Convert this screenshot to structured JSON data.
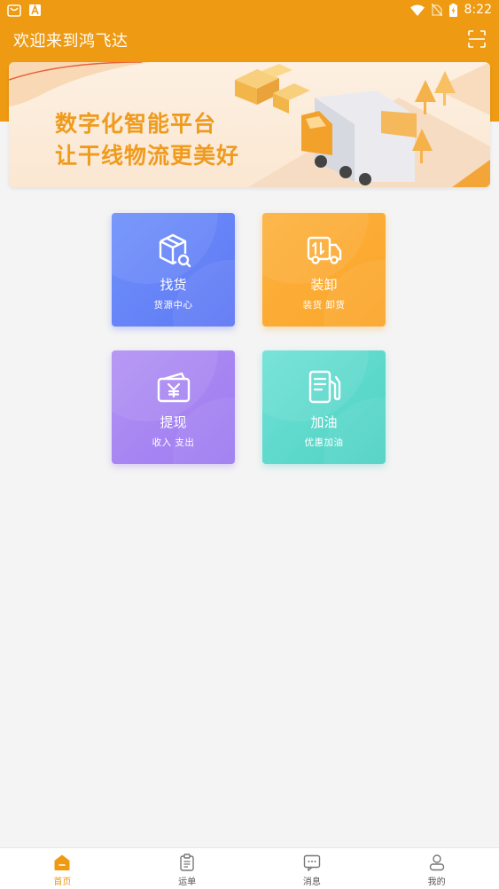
{
  "status_bar": {
    "time": "8:22",
    "left_icons": [
      "shopping-bag-icon",
      "android-a-icon"
    ],
    "right_icons": [
      "wifi-icon",
      "no-sim-icon",
      "battery-icon"
    ]
  },
  "header": {
    "title": "欢迎来到鸿飞达",
    "scan_icon": "scan-icon"
  },
  "banner": {
    "line1": "数字化智能平台",
    "line2": "让干线物流更美好"
  },
  "cards": [
    {
      "title": "找货",
      "subtitle": "货源中心",
      "icon": "box-search-icon",
      "color": "#6584f8"
    },
    {
      "title": "装卸",
      "subtitle": "装货  卸货",
      "icon": "truck-icon",
      "color": "#fba92f"
    },
    {
      "title": "提现",
      "subtitle": "收入  支出",
      "icon": "wallet-yen-icon",
      "color": "#a685f3"
    },
    {
      "title": "加油",
      "subtitle": "优惠加油",
      "icon": "fuel-pump-icon",
      "color": "#58d8ca"
    }
  ],
  "bottom_nav": [
    {
      "label": "首页",
      "icon": "home-icon",
      "active": true
    },
    {
      "label": "运单",
      "icon": "clipboard-icon",
      "active": false
    },
    {
      "label": "消息",
      "icon": "message-icon",
      "active": false
    },
    {
      "label": "我的",
      "icon": "user-icon",
      "active": false
    }
  ],
  "colors": {
    "brand": "#ee9a12",
    "background": "#f4f4f4",
    "nav_active": "#ee9a12",
    "nav_inactive": "#555555"
  }
}
